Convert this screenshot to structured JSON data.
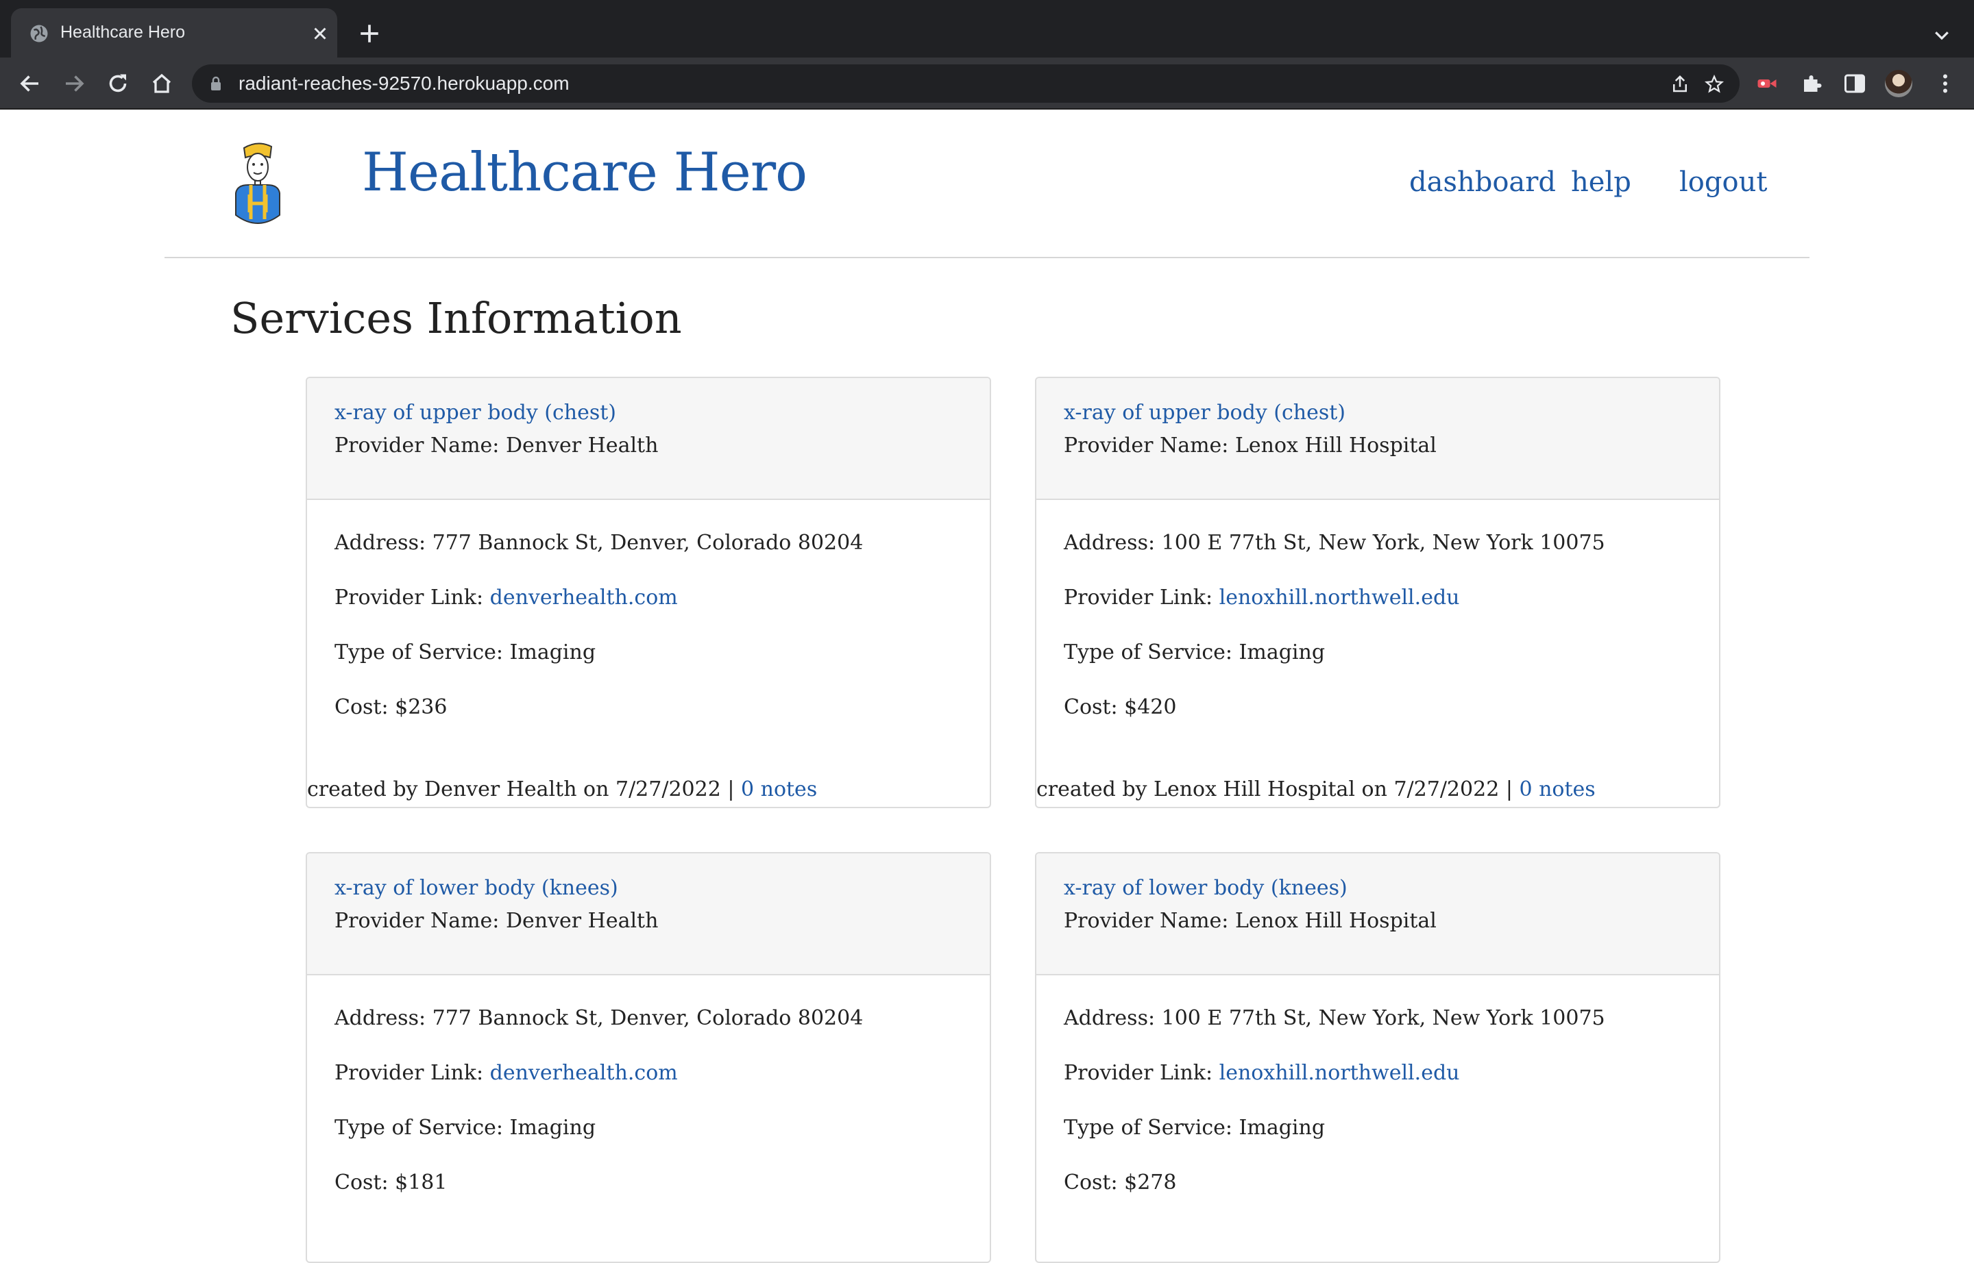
{
  "browser": {
    "tab_title": "Healthcare Hero",
    "url": "radiant-reaches-92570.herokuapp.com"
  },
  "site": {
    "title": "Healthcare Hero",
    "nav": [
      "dashboard",
      "help",
      "logout"
    ]
  },
  "page": {
    "title": "Services Information"
  },
  "labels": {
    "provider_name": "Provider Name: ",
    "address": "Address: ",
    "provider_link": "Provider Link: ",
    "type_of_service": "Type of Service: ",
    "cost": "Cost: ",
    "created_by": "created by ",
    "on": " on ",
    "sep": " | "
  },
  "cards": [
    {
      "service": "x-ray of upper body (chest)",
      "provider": "Denver Health",
      "address": "777 Bannock St, Denver, Colorado 80204",
      "link": "denverhealth.com",
      "type": "Imaging",
      "cost": "$236",
      "created_by": "Denver Health",
      "date": "7/27/2022",
      "notes": "0 notes"
    },
    {
      "service": "x-ray of upper body (chest)",
      "provider": "Lenox Hill Hospital",
      "address": "100 E 77th St, New York, New York 10075",
      "link": "lenoxhill.northwell.edu",
      "type": "Imaging",
      "cost": "$420",
      "created_by": "Lenox Hill Hospital",
      "date": "7/27/2022",
      "notes": "0 notes"
    },
    {
      "service": "x-ray of lower body (knees)",
      "provider": "Denver Health",
      "address": "777 Bannock St, Denver, Colorado 80204",
      "link": "denverhealth.com",
      "type": "Imaging",
      "cost": "$181"
    },
    {
      "service": "x-ray of lower body (knees)",
      "provider": "Lenox Hill Hospital",
      "address": "100 E 77th St, New York, New York 10075",
      "link": "lenoxhill.northwell.edu",
      "type": "Imaging",
      "cost": "$278"
    }
  ]
}
